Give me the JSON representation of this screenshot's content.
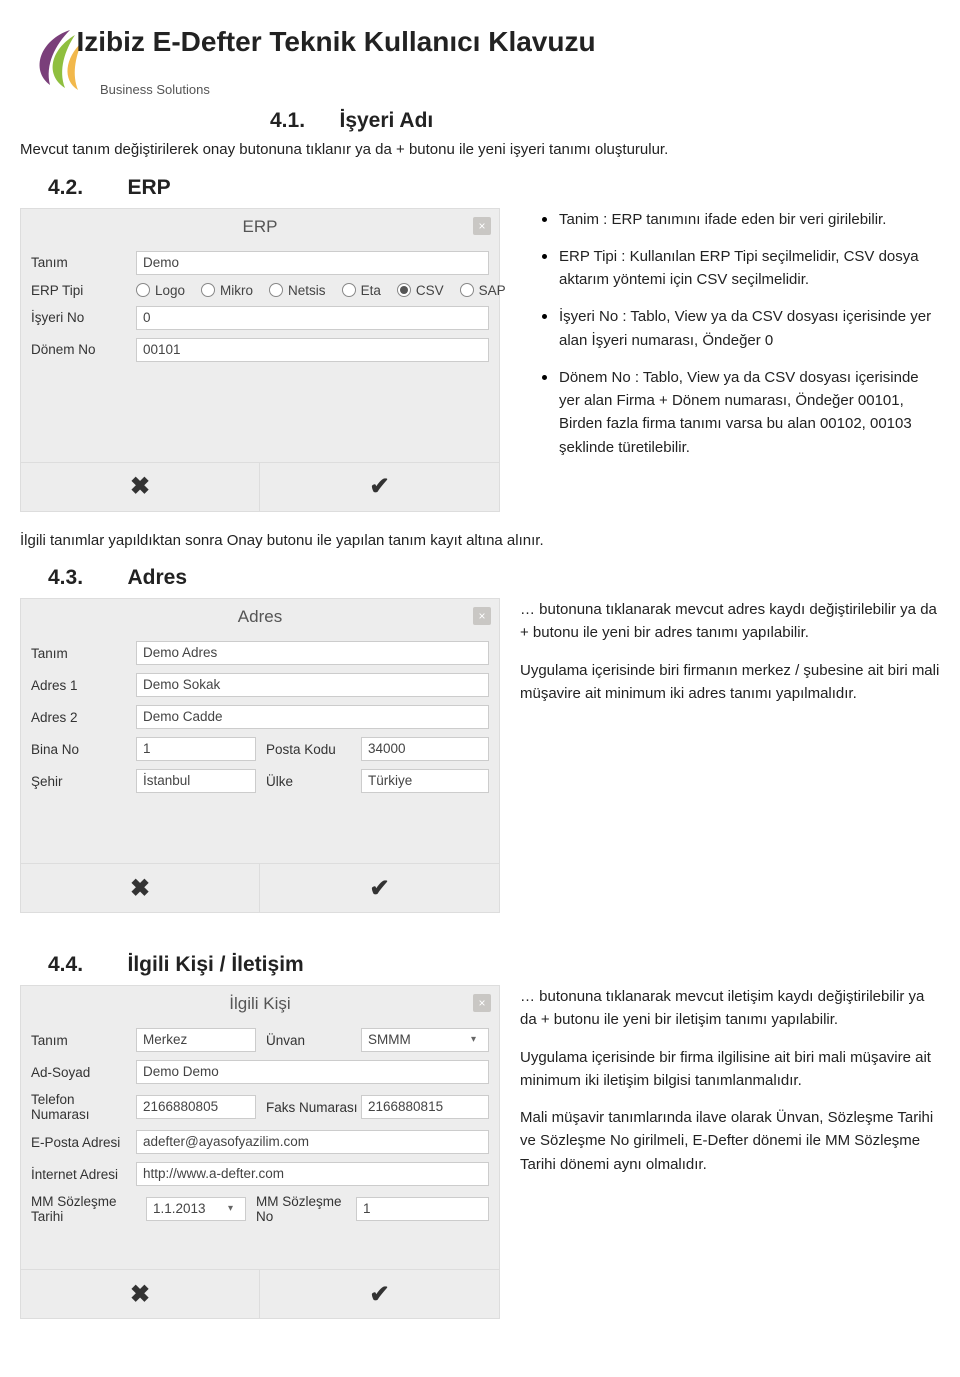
{
  "header": {
    "doc_title": "Izibiz E-Defter Teknik Kullanıcı Klavuzu",
    "logo_subtitle": "Business Solutions"
  },
  "sec_4_1": {
    "num": "4.1.",
    "title": "İşyeri Adı",
    "text": "Mevcut tanım değiştirilerek onay butonuna tıklanır ya da + butonu ile yeni işyeri tanımı oluşturulur."
  },
  "sec_4_2": {
    "num": "4.2.",
    "title": "ERP",
    "dialog": {
      "title": "ERP",
      "tanim_label": "Tanım",
      "tanim_value": "Demo",
      "erp_tipi_label": "ERP Tipi",
      "radio_options": [
        "Logo",
        "Mikro",
        "Netsis",
        "Eta",
        "CSV",
        "SAP"
      ],
      "radio_selected": "CSV",
      "isyeri_no_label": "İşyeri No",
      "isyeri_no_value": "0",
      "donem_no_label": "Dönem No",
      "donem_no_value": "00101"
    },
    "side": {
      "p1": "Tanim : ERP tanımını ifade eden bir veri girilebilir.",
      "p2": "ERP Tipi : Kullanılan ERP Tipi seçilmelidir, CSV dosya aktarım yöntemi için CSV seçilmelidir.",
      "p3": "İşyeri No : Tablo, View ya da CSV dosyası içerisinde yer alan İşyeri numarası, Öndeğer 0",
      "p4": "Dönem No : Tablo, View ya da CSV dosyası içerisinde yer alan Firma + Dönem numarası, Öndeğer 00101, Birden fazla firma tanımı varsa bu alan 00102, 00103 şeklinde türetilebilir."
    },
    "after_text": "İlgili tanımlar yapıldıktan sonra Onay butonu ile yapılan tanım kayıt altına alınır."
  },
  "sec_4_3": {
    "num": "4.3.",
    "title": "Adres",
    "dialog": {
      "title": "Adres",
      "tanim_label": "Tanım",
      "tanim_value": "Demo Adres",
      "adres1_label": "Adres 1",
      "adres1_value": "Demo Sokak",
      "adres2_label": "Adres 2",
      "adres2_value": "Demo Cadde",
      "binano_label": "Bina No",
      "binano_value": "1",
      "posta_kodu_label": "Posta Kodu",
      "posta_kodu_value": "34000",
      "sehir_label": "Şehir",
      "sehir_value": "İstanbul",
      "ulke_label": "Ülke",
      "ulke_value": "Türkiye"
    },
    "side": {
      "p1": "… butonuna tıklanarak mevcut adres kaydı değiştirilebilir ya da + butonu ile yeni bir adres tanımı yapılabilir.",
      "p2": "Uygulama içerisinde biri firmanın merkez / şubesine ait biri mali müşavire ait minimum iki adres tanımı yapılmalıdır."
    }
  },
  "sec_4_4": {
    "num": "4.4.",
    "title": "İlgili Kişi / İletişim",
    "dialog": {
      "title": "İlgili Kişi",
      "tanim_label": "Tanım",
      "tanim_value": "Merkez",
      "unvan_label": "Ünvan",
      "unvan_value": "SMMM",
      "adsoyad_label": "Ad-Soyad",
      "adsoyad_value": "Demo Demo",
      "tel_label": "Telefon Numarası",
      "tel_value": "2166880805",
      "faks_label": "Faks Numarası",
      "faks_value": "2166880815",
      "eposta_label": "E-Posta Adresi",
      "eposta_value": "adefter@ayasofyazilim.com",
      "internet_label": "İnternet Adresi",
      "internet_value": "http://www.a-defter.com",
      "mm_tarih_label": "MM Sözleşme Tarihi",
      "mm_tarih_value": "1.1.2013",
      "mm_no_label": "MM Sözleşme No",
      "mm_no_value": "1"
    },
    "side": {
      "p1": "… butonuna tıklanarak mevcut iletişim kaydı değiştirilebilir ya da + butonu ile yeni bir iletişim tanımı yapılabilir.",
      "p2": "Uygulama içerisinde bir firma ilgilisine ait biri mali müşavire ait minimum iki iletişim bilgisi tanımlanmalıdır.",
      "p3": "Mali müşavir tanımlarında ilave olarak Ünvan, Sözleşme Tarihi ve Sözleşme No girilmeli, E-Defter dönemi ile MM Sözleşme Tarihi dönemi aynı olmalıdır."
    }
  }
}
